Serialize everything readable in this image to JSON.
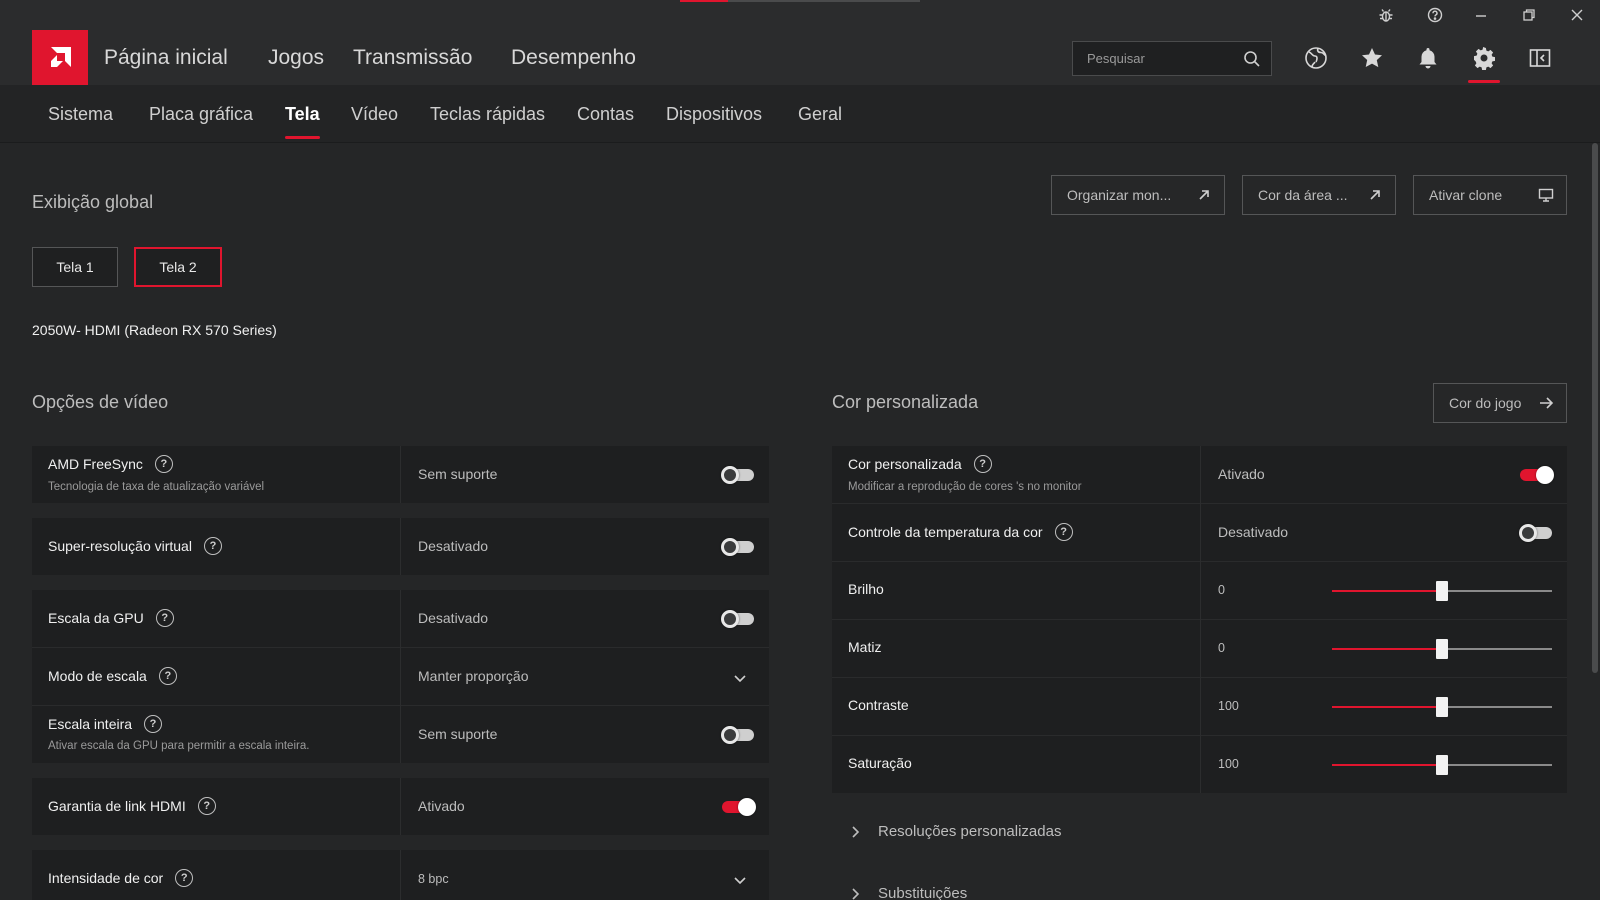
{
  "topnav": {
    "items": [
      "Página inicial",
      "Jogos",
      "Transmissão",
      "Desempenho"
    ],
    "search_placeholder": "Pesquisar"
  },
  "subnav": {
    "items": [
      "Sistema",
      "Placa gráfica",
      "Tela",
      "Vídeo",
      "Teclas rápidas",
      "Contas",
      "Dispositivos",
      "Geral"
    ],
    "active": "Tela"
  },
  "global_display": {
    "title": "Exibição global",
    "actions": [
      "Organizar mon...",
      "Cor da área ...",
      "Ativar clone"
    ],
    "tabs": [
      "Tela 1",
      "Tela 2"
    ],
    "active_tab": "Tela 2",
    "display_name": "2050W- HDMI (Radeon RX 570 Series)"
  },
  "video_options": {
    "title": "Opções de vídeo",
    "rows": [
      {
        "label": "AMD FreeSync",
        "desc": "Tecnologia de taxa de atualização variável",
        "value": "Sem suporte"
      },
      {
        "label": "Super-resolução virtual",
        "value": "Desativado"
      },
      {
        "label": "Escala da GPU",
        "value": "Desativado"
      },
      {
        "label": "Modo de escala",
        "value": "Manter proporção"
      },
      {
        "label": "Escala inteira",
        "desc": "Ativar escala da GPU para permitir a escala inteira.",
        "value": "Sem suporte"
      },
      {
        "label": "Garantia de link HDMI",
        "value": "Ativado"
      },
      {
        "label": "Intensidade de cor",
        "value": "8 bpc"
      }
    ]
  },
  "custom_color": {
    "title": "Cor personalizada",
    "game_color_button": "Cor do jogo",
    "rows": [
      {
        "label": "Cor personalizada",
        "desc": "Modificar a reprodução de cores 's no monitor",
        "value": "Ativado"
      },
      {
        "label": "Controle da temperatura da cor",
        "value": "Desativado"
      },
      {
        "label": "Brilho",
        "value": "0"
      },
      {
        "label": "Matiz",
        "value": "0"
      },
      {
        "label": "Contraste",
        "value": "100"
      },
      {
        "label": "Saturação",
        "value": "100"
      }
    ],
    "slider_levels": [
      0.5,
      0.5,
      0.5,
      0.5
    ]
  },
  "expanders": [
    "Resoluções personalizadas",
    "Substituições"
  ],
  "colors": {
    "accent": "#e0152e",
    "background": "#252627",
    "card": "#1e1f20"
  }
}
